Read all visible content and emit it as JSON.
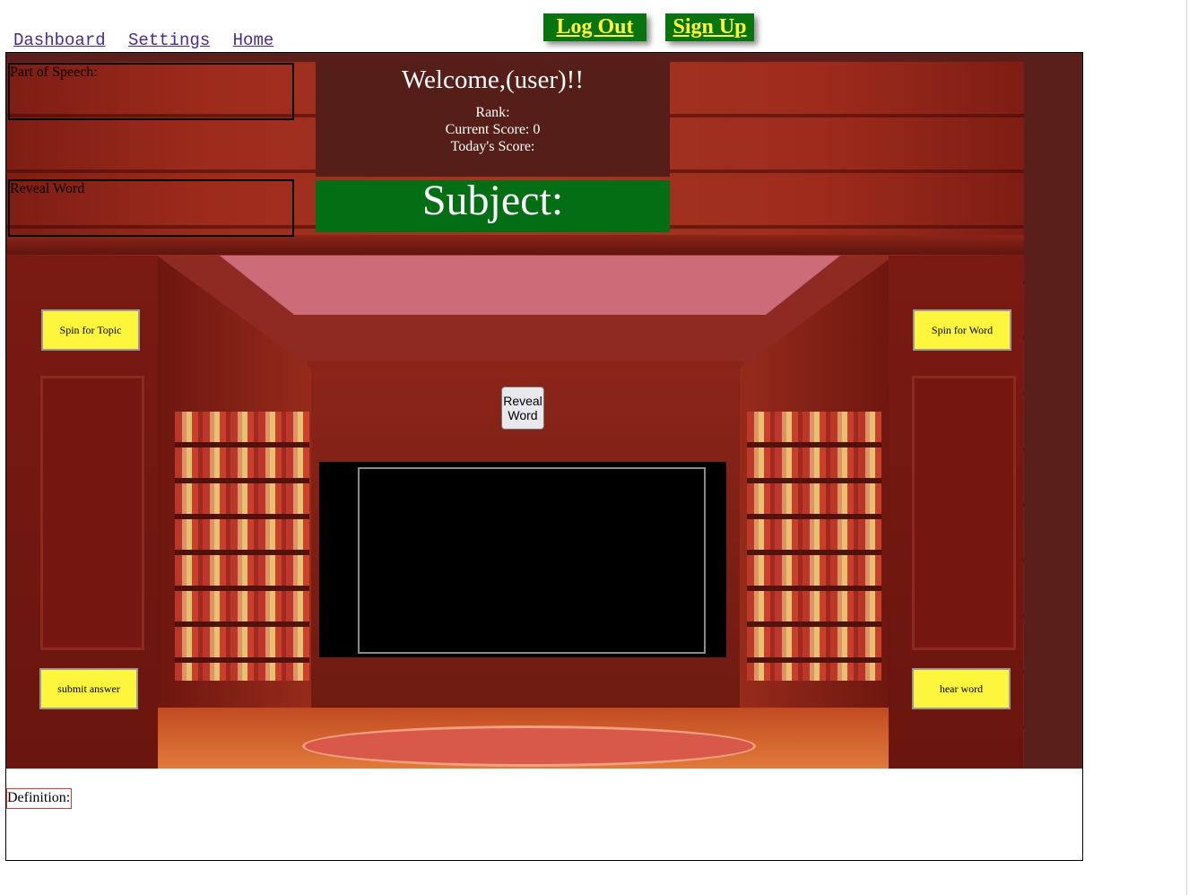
{
  "nav": {
    "links": [
      "Dashboard",
      "Settings",
      "Home"
    ]
  },
  "auth": {
    "logout": "Log Out",
    "signup": "Sign Up"
  },
  "header": {
    "welcome": "Welcome,(user)!!",
    "rank_label": "Rank:",
    "current_score_label": "Current Score:",
    "current_score_value": "0",
    "todays_score_label": "Today's Score:",
    "subject_label": "Subject:"
  },
  "panels": {
    "part_of_speech": "Part of Speech:",
    "reveal_word": "Reveal Word"
  },
  "controls": {
    "spin_topic": "Spin for Topic",
    "spin_word": "Spin for Word",
    "reveal_word_button": "Reveal Word",
    "submit_answer": "submit answer",
    "hear_word": "hear word"
  },
  "footer": {
    "definition_label": "Definition:"
  },
  "colors": {
    "button_yellow": "#fdf63d",
    "subject_green": "#036e14",
    "auth_green": "#08740f",
    "auth_text": "#ffff3a",
    "info_panel": "#561e18"
  }
}
